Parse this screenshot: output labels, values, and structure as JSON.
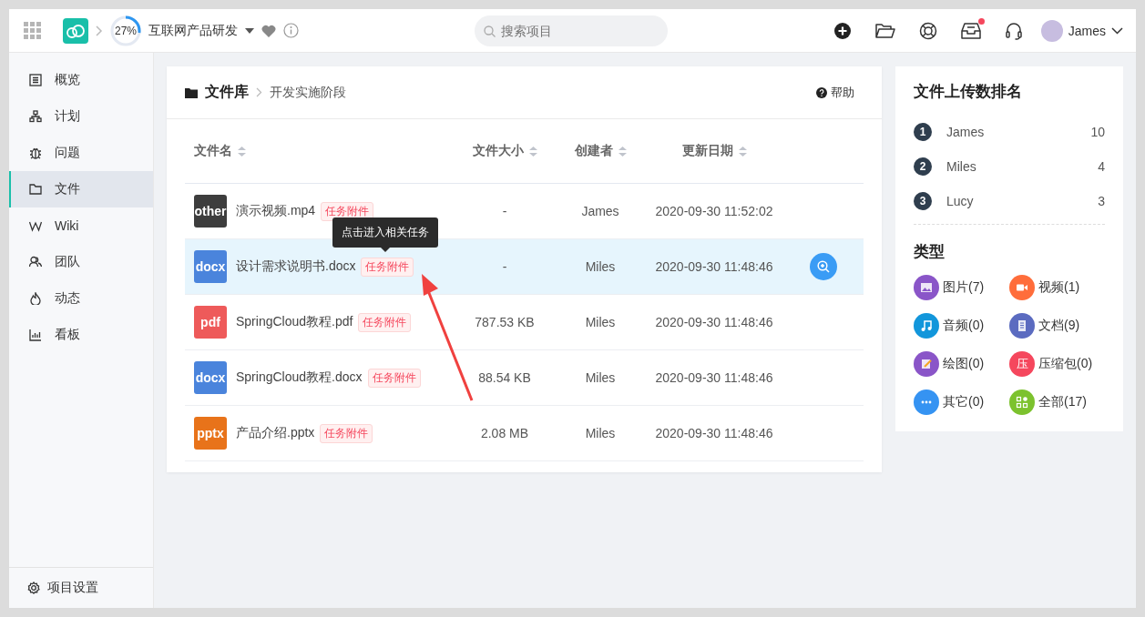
{
  "header": {
    "progress": {
      "label": "27%",
      "level": 0.27
    },
    "project": "互联网产品研发",
    "search": {
      "placeholder": "搜索项目"
    },
    "inbox_notification": true,
    "user": "James"
  },
  "sidebar": {
    "items": [
      {
        "label": "概览",
        "kind": "overview",
        "selected": false
      },
      {
        "label": "计划",
        "kind": "plan",
        "selected": false
      },
      {
        "label": "问题",
        "kind": "issue",
        "selected": false
      },
      {
        "label": "文件",
        "kind": "file",
        "selected": true
      },
      {
        "label": "Wiki",
        "kind": "wiki",
        "selected": false
      },
      {
        "label": "团队",
        "kind": "team",
        "selected": false
      },
      {
        "label": "动态",
        "kind": "activity",
        "selected": false
      },
      {
        "label": "看板",
        "kind": "board",
        "selected": false
      }
    ],
    "footer": "项目设置"
  },
  "breadcrumb": {
    "root": "文件库",
    "current": "开发实施阶段"
  },
  "help": "帮助",
  "table": {
    "columns": [
      "文件名",
      "文件大小",
      "创建者",
      "更新日期"
    ],
    "rows": [
      {
        "type": "other",
        "name": "演示视频.mp4",
        "tag": "任务附件",
        "size": "-",
        "creator": "James",
        "date": "2020-09-30 11:52:02",
        "selected": false
      },
      {
        "type": "docx",
        "name": "设计需求说明书.docx",
        "tag": "任务附件",
        "size": "-",
        "creator": "Miles",
        "date": "2020-09-30 11:48:46",
        "selected": true
      },
      {
        "type": "pdf",
        "name": "SpringCloud教程.pdf",
        "tag": "任务附件",
        "size": "787.53 KB",
        "creator": "Miles",
        "date": "2020-09-30 11:48:46",
        "selected": false
      },
      {
        "type": "docx",
        "name": "SpringCloud教程.docx",
        "tag": "任务附件",
        "size": "88.54 KB",
        "creator": "Miles",
        "date": "2020-09-30 11:48:46",
        "selected": false
      },
      {
        "type": "pptx",
        "name": "产品介绍.pptx",
        "tag": "任务附件",
        "size": "2.08 MB",
        "creator": "Miles",
        "date": "2020-09-30 11:48:46",
        "selected": false
      }
    ]
  },
  "tooltip": "点击进入相关任务",
  "ranking": {
    "title": "文件上传数排名",
    "items": [
      {
        "rank": "1",
        "name": "James",
        "count": "10"
      },
      {
        "rank": "2",
        "name": "Miles",
        "count": "4"
      },
      {
        "rank": "3",
        "name": "Lucy",
        "count": "3"
      }
    ]
  },
  "types": {
    "title": "类型",
    "items": [
      {
        "kind": "image",
        "label": "图片(7)",
        "color": "#8a55c8"
      },
      {
        "kind": "video",
        "label": "视频(1)",
        "color": "#ff6d3b"
      },
      {
        "kind": "audio",
        "label": "音频(0)",
        "color": "#1296db"
      },
      {
        "kind": "doc",
        "label": "文档(9)",
        "color": "#5b6bc0"
      },
      {
        "kind": "drawing",
        "label": "绘图(0)",
        "color": "#8a55c8"
      },
      {
        "kind": "zip",
        "label": "压缩包(0)",
        "color": "#f5475d",
        "glyph": "压"
      },
      {
        "kind": "other",
        "label": "其它(0)",
        "color": "#3593f2"
      },
      {
        "kind": "all",
        "label": "全部(17)",
        "color": "#7cc22e"
      }
    ]
  }
}
